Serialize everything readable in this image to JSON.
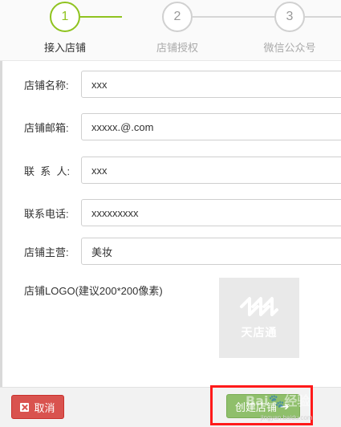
{
  "stepper": {
    "steps": [
      {
        "number": "1",
        "label": "接入店铺"
      },
      {
        "number": "2",
        "label": "店铺授权"
      },
      {
        "number": "3",
        "label": "微信公众号"
      }
    ]
  },
  "form": {
    "fields": [
      {
        "label": "店铺名称:",
        "value": "xxx"
      },
      {
        "label": "店铺邮箱:",
        "value": "xxxxx.@.com"
      },
      {
        "label": "联  系  人:",
        "value": "xxx"
      },
      {
        "label": "联系电话:",
        "value": "xxxxxxxxx"
      },
      {
        "label": "店铺主营:",
        "value": "美妆"
      }
    ],
    "logo_label": "店铺LOGO(建议200*200像素)",
    "logo_text": "天店通"
  },
  "footer": {
    "cancel_label": "取消",
    "create_label": "创建店铺"
  },
  "watermark": {
    "text": "Bai🐾经验",
    "url": "jingyan.baidu.com"
  },
  "colors": {
    "accent_green": "#8fc31f",
    "cancel_red": "#d9534f",
    "create_green": "#8fbf6b",
    "highlight_red": "#ff1a1a"
  }
}
